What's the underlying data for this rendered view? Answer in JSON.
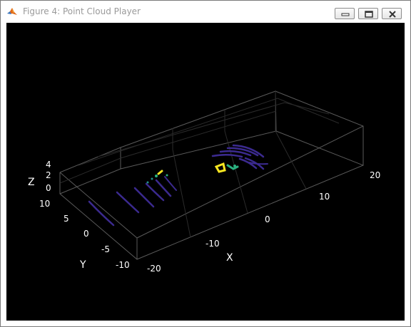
{
  "window": {
    "title": "Figure 4: Point Cloud Player"
  },
  "icons": {
    "app": "matlab-icon",
    "minimize": "minimize-icon",
    "maximize": "maximize-icon",
    "close": "close-icon"
  },
  "axes": {
    "xlabel": "X",
    "ylabel": "Y",
    "zlabel": "Z",
    "x_ticks": [
      "-20",
      "-10",
      "0",
      "10",
      "20"
    ],
    "y_ticks": [
      "10",
      "5",
      "0",
      "-5",
      "-10"
    ],
    "z_ticks": [
      "4",
      "2",
      "0"
    ],
    "xlim": [
      -20,
      20
    ],
    "ylim": [
      -10,
      10
    ],
    "zlim": [
      0,
      4
    ],
    "background": "#000000",
    "grid": true
  },
  "colors": {
    "pointcloud_low": "#3b2a8f",
    "pointcloud_mid": "#2bb07f",
    "pointcloud_high": "#f9e721"
  }
}
